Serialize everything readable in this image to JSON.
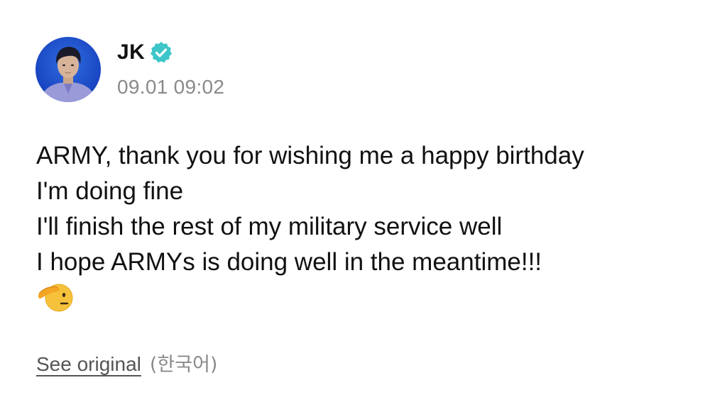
{
  "author": {
    "name": "JK",
    "verified_icon": "verified-badge-icon",
    "avatar_icon": "profile-avatar"
  },
  "post": {
    "timestamp": "09.01 09:02",
    "lines": [
      "ARMY, thank you for wishing me a happy birthday",
      "I'm doing fine",
      "I'll finish the rest of my military service well",
      "I hope ARMYs is doing well in the meantime!!!"
    ],
    "emoji_icon": "saluting-face-emoji"
  },
  "translation": {
    "see_original_label": "See original",
    "language_label": "(한국어)"
  },
  "colors": {
    "verified": "#3cc6c9",
    "timestamp": "#8a8a8a",
    "text": "#111111"
  }
}
